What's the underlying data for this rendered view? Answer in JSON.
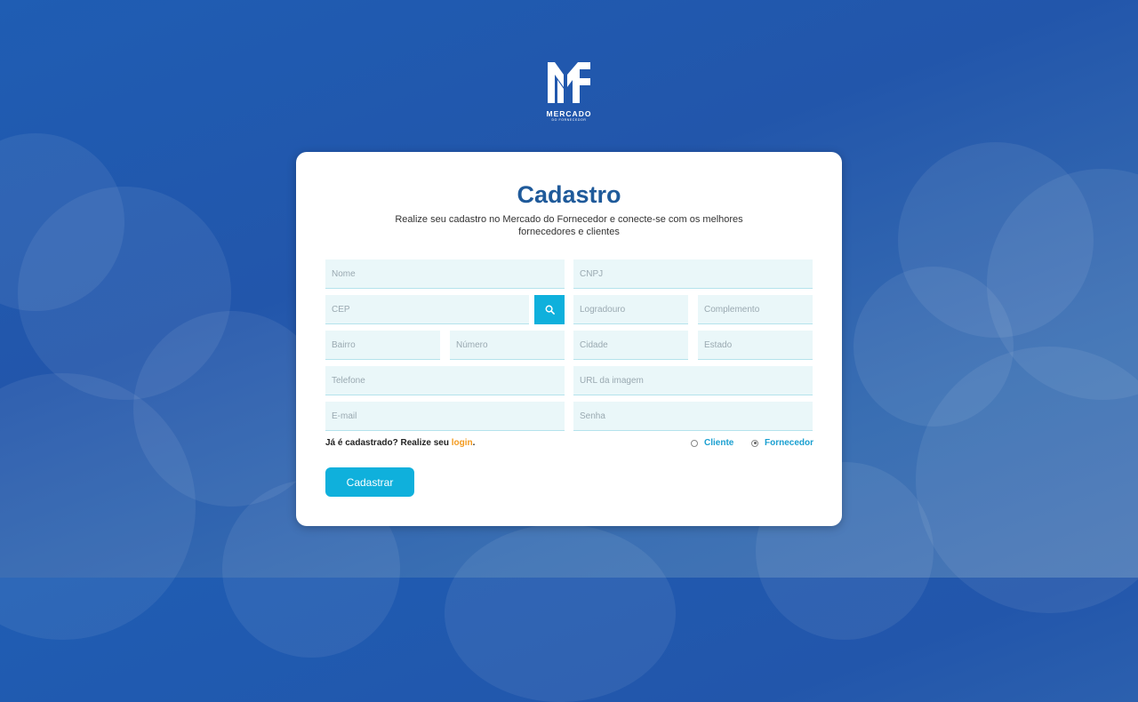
{
  "brand": {
    "name": "MERCADO",
    "tagline": "DO FORNECEDOR",
    "logo_icon": "mf-logo-icon"
  },
  "form": {
    "title": "Cadastro",
    "subtitle_line1": "Realize seu cadastro no Mercado do Fornecedor e conecte-se com os melhores",
    "subtitle_line2": "fornecedores e clientes",
    "fields": {
      "nome": "Nome",
      "cnpj": "CNPJ",
      "cep": "CEP",
      "logradouro": "Logradouro",
      "complemento": "Complemento",
      "bairro": "Bairro",
      "numero": "Número",
      "cidade": "Cidade",
      "estado": "Estado",
      "telefone": "Telefone",
      "url_imagem": "URL da imagem",
      "email": "E-mail",
      "senha": "Senha"
    },
    "search_icon": "search-icon",
    "login_prompt": "Já é cadastrado? Realize seu ",
    "login_link": "login",
    "login_suffix": ".",
    "account_types": {
      "cliente": "Cliente",
      "fornecedor": "Fornecedor",
      "selected": "Fornecedor"
    },
    "submit_label": "Cadastrar"
  },
  "colors": {
    "accent": "#0fb0dc",
    "title": "#1f5a9a",
    "link": "#f39a1e",
    "radio_label": "#1a9fd0",
    "background": "#2256ab"
  }
}
